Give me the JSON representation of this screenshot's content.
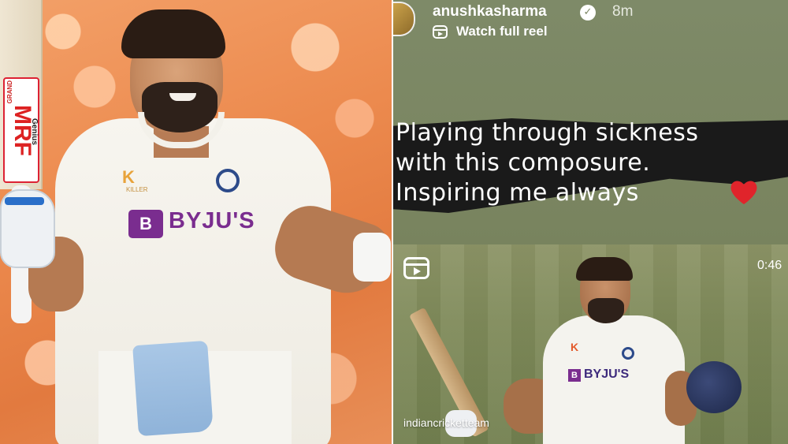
{
  "left_photo": {
    "bat_brand": "MRF",
    "bat_brand_sub": "GRAND",
    "bat_model": "Genius",
    "jersey_sponsor_badge": "B",
    "jersey_sponsor": "BYJU'S",
    "kit_logo": "K",
    "kit_logo_sub": "KILLER"
  },
  "story": {
    "username": "anushkasharma",
    "time_ago": "8m",
    "watch_reel_label": "Watch full reel",
    "caption": "Playing through sickness\nwith this composure.\nInspiring me always",
    "heart_color": "#e0242b",
    "video": {
      "duration": "0:46",
      "tagged_account": "indiancricketteam",
      "sponsor_badge": "B",
      "sponsor": "BYJU'S",
      "kit_logo": "K"
    }
  },
  "icons": {
    "verified": "verified-badge-icon",
    "reel": "reel-icon",
    "heart": "heart-icon"
  }
}
